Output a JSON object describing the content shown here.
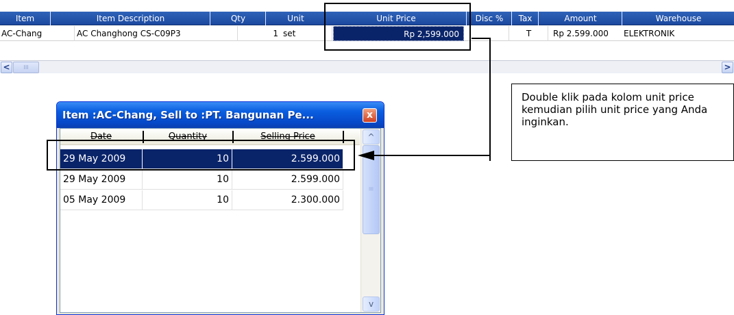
{
  "grid": {
    "columns": [
      "Item",
      "Item Description",
      "Qty",
      "Unit",
      "Unit Price",
      "Disc %",
      "Tax",
      "Amount",
      "Warehouse"
    ],
    "row": {
      "item": "AC-Chang",
      "description": "AC Changhong CS-C09P3",
      "qty": "1",
      "unit": "set",
      "unit_price": "Rp 2,599.000",
      "disc": "",
      "tax": "T",
      "amount": "Rp 2.599.000",
      "warehouse": "ELEKTRONIK"
    },
    "scroll_left": "<",
    "scroll_right": ">",
    "thumb_grip": "III"
  },
  "note": {
    "text": "Double klik pada kolom unit price kemudian pilih unit price yang Anda inginkan."
  },
  "dialog": {
    "title": "Item :AC-Chang, Sell to :PT. Bangunan Pe...",
    "close_glyph": "x",
    "columns": [
      "Date",
      "Quantity",
      "Selling Price"
    ],
    "rows": [
      {
        "date": "29 May 2009",
        "quantity": "10",
        "price": "2.599.000"
      },
      {
        "date": "29 May 2009",
        "quantity": "10",
        "price": "2.599.000"
      },
      {
        "date": "05 May 2009",
        "quantity": "10",
        "price": "2.300.000"
      }
    ],
    "scroll_up": "^",
    "scroll_down": "v",
    "thumb_grip": "≡"
  },
  "colors": {
    "grid_header": "#1c49a0",
    "selection": "#0a246a",
    "dialog_title": "#0648c8"
  }
}
